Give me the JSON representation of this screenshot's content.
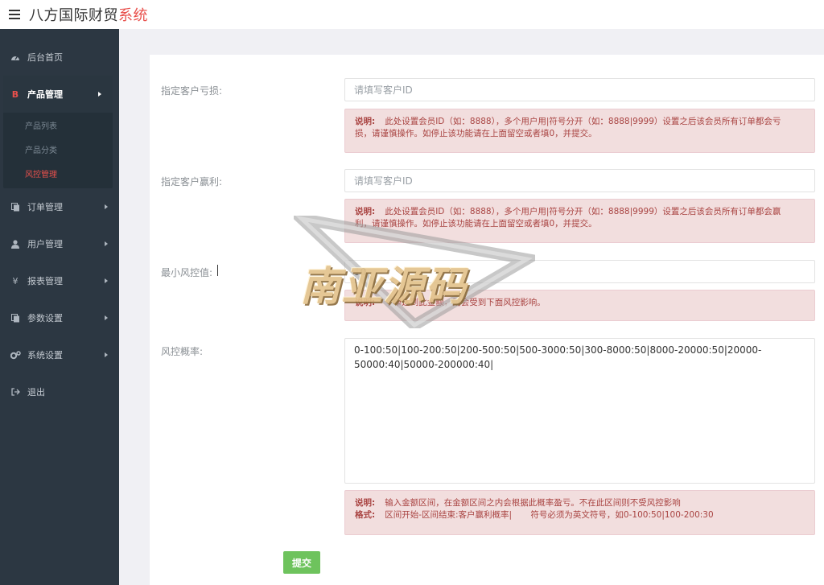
{
  "header": {
    "title_main": "八方国际财贸",
    "title_accent": "系统"
  },
  "sidebar": {
    "items": [
      {
        "label": "后台首页",
        "icon": "dashboard-icon"
      },
      {
        "label": "产品管理",
        "icon": "bitcoin-icon",
        "icon_char": "B",
        "open": true,
        "children": [
          {
            "label": "产品列表"
          },
          {
            "label": "产品分类"
          },
          {
            "label": "风控管理",
            "active": true
          }
        ]
      },
      {
        "label": "订单管理",
        "icon": "copy-icon"
      },
      {
        "label": "用户管理",
        "icon": "user-icon"
      },
      {
        "label": "报表管理",
        "icon": "yen-icon",
        "icon_char": "¥"
      },
      {
        "label": "参数设置",
        "icon": "copy-icon"
      },
      {
        "label": "系统设置",
        "icon": "cogs-icon"
      },
      {
        "label": "退出",
        "icon": "sign-out-icon"
      }
    ]
  },
  "form": {
    "loss": {
      "label": "指定客户亏损:",
      "placeholder": "请填写客户ID",
      "value": "",
      "note_title": "说明:",
      "note_line1": "此处设置会员ID（如：8888），多个用户用|符号分开（如：8888|9999）设置之后该会员所有订单都会亏",
      "note_line2": "损，请谨慎操作。如停止该功能请在上面留空或者填0，并提交。"
    },
    "profit": {
      "label": "指定客户赢利:",
      "placeholder": "请填写客户ID",
      "value": "",
      "note_title": "说明:",
      "note_line1": "此处设置会员ID（如：8888），多个用户用|符号分开（如：8888|9999）设置之后该会员所有订单都会赢",
      "note_line2": "利，请谨慎操作。如停止该功能请在上面留空或者填0，并提交。"
    },
    "min_risk": {
      "label": "最小风控值:",
      "value": "10",
      "note_title": "说明:",
      "note_line1": "下单达到此金额，则会受到下面风控影响。"
    },
    "risk_rate": {
      "label": "风控概率:",
      "value": "0-100:50|100-200:50|200-500:50|500-3000:50|300-8000:50|8000-20000:50|20000-50000:40|50000-200000:40|",
      "note_title": "说明:",
      "note_line1": "输入金额区间，在金额区间之内会根据此概率盈亏。不在此区间则不受风控影响",
      "format_title": "格式:",
      "format_line": "区间开始-区间结束:客户赢利概率|       符号必须为英文符号，如0-100:50|100-200:30"
    },
    "submit_label": "提交"
  },
  "watermark": {
    "text": "南亚源码"
  },
  "colors": {
    "sidebar_bg": "#2c3742",
    "accent_red": "#e8504c",
    "note_bg": "#f2dede",
    "note_text": "#a94442",
    "submit_green": "#6ec35d"
  }
}
